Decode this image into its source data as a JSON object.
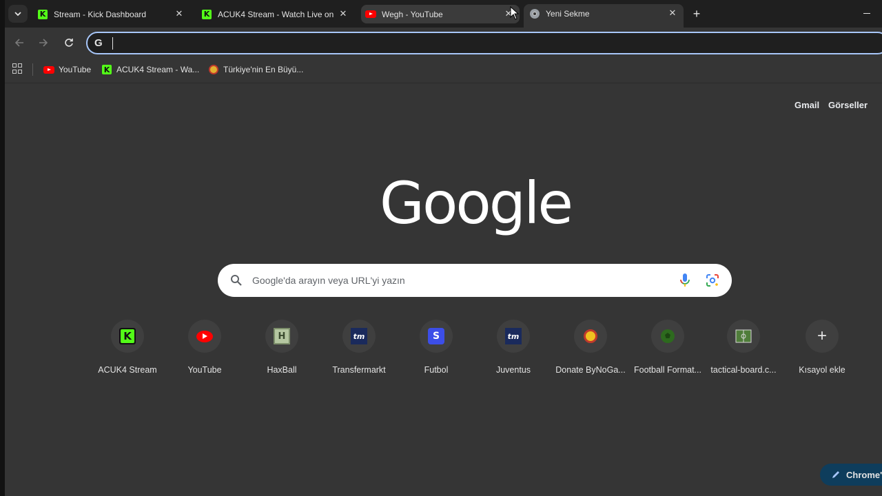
{
  "tabs": [
    {
      "title": "Stream - Kick Dashboard",
      "icon": "kick-icon"
    },
    {
      "title": "ACUK4 Stream - Watch Live on",
      "icon": "kick-icon"
    },
    {
      "title": "Wegh - YouTube",
      "icon": "youtube-icon"
    },
    {
      "title": "Yeni Sekme",
      "icon": "chrome-icon"
    }
  ],
  "tab_close": "✕",
  "new_tab": "+",
  "omnibox": {
    "g_label": "G",
    "value": ""
  },
  "bookmarks": [
    {
      "label": "YouTube",
      "icon": "youtube-icon"
    },
    {
      "label": "ACUK4 Stream - Wa...",
      "icon": "kick-icon"
    },
    {
      "label": "Türkiye'nin En Büyü...",
      "icon": "site-icon"
    }
  ],
  "header_links": {
    "gmail": "Gmail",
    "images": "Görseller"
  },
  "logo_text": "Google",
  "search": {
    "placeholder": "Google'da arayın veya URL'yi yazın"
  },
  "shortcuts": [
    {
      "label": "ACUK4 Stream",
      "icon": "kick-icon",
      "glyph": "K"
    },
    {
      "label": "YouTube",
      "icon": "youtube-icon",
      "glyph": ""
    },
    {
      "label": "HaxBall",
      "icon": "haxball-icon",
      "glyph": "H"
    },
    {
      "label": "Transfermarkt",
      "icon": "transfermarkt-icon",
      "glyph": "tm"
    },
    {
      "label": "Futbol",
      "icon": "futbol-icon",
      "glyph": "S"
    },
    {
      "label": "Juventus",
      "icon": "transfermarkt-icon",
      "glyph": "tm"
    },
    {
      "label": "Donate ByNoGa...",
      "icon": "donate-icon",
      "glyph": ""
    },
    {
      "label": "Football Format...",
      "icon": "football-icon",
      "glyph": ""
    },
    {
      "label": "tactical-board.c...",
      "icon": "tactical-board-icon",
      "glyph": ""
    },
    {
      "label": "Kısayol ekle",
      "icon": "plus-icon",
      "glyph": "+"
    }
  ],
  "customize_label": "Chrome'u",
  "colors": {
    "kick": "#53fc18",
    "youtube": "#ff0000",
    "accent": "#a8c7fa"
  }
}
